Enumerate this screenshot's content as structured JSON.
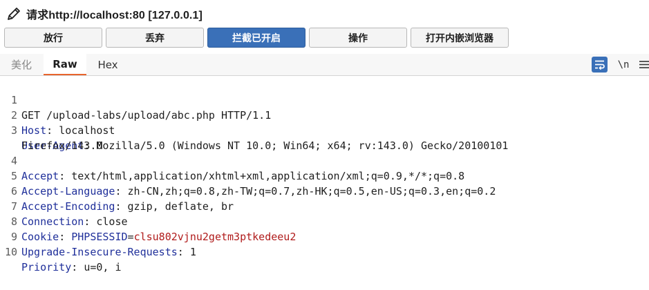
{
  "title": {
    "text": "请求http://localhost:80  [127.0.0.1]",
    "icon": "pencil-icon"
  },
  "buttons": {
    "forward": "放行",
    "drop": "丢弃",
    "intercept": "拦截已开启",
    "action": "操作",
    "open_browser": "打开内嵌浏览器"
  },
  "tabs": {
    "pretty": "美化",
    "raw": "Raw",
    "hex": "Hex",
    "newline_toggle": "\\n"
  },
  "colors": {
    "accent": "#3a70b8",
    "tab_underline": "#e8642c",
    "header_key": "#1f2f9a",
    "cookie_value": "#b01b1b"
  },
  "request": {
    "lines": [
      {
        "num": "1",
        "text": "GET /upload-labs/upload/abc.php HTTP/1.1"
      },
      {
        "num": "2",
        "key": "Host",
        "value": "localhost"
      },
      {
        "num": "3",
        "key": "User-Agent",
        "value": "Mozilla/5.0 (Windows NT 10.0; Win64; x64; rv:143.0) Gecko/20100101",
        "continuation": "Firefox/143.0"
      },
      {
        "num": "4",
        "key": "Accept",
        "value": "text/html,application/xhtml+xml,application/xml;q=0.9,*/*;q=0.8"
      },
      {
        "num": "5",
        "key": "Accept-Language",
        "value": "zh-CN,zh;q=0.8,zh-TW;q=0.7,zh-HK;q=0.5,en-US;q=0.3,en;q=0.2"
      },
      {
        "num": "6",
        "key": "Accept-Encoding",
        "value": "gzip, deflate, br"
      },
      {
        "num": "7",
        "key": "Connection",
        "value": "close"
      },
      {
        "num": "8",
        "key": "Cookie",
        "cookie_name": "PHPSESSID",
        "cookie_value": "clsu802vjnu2getm3ptkedeeu2"
      },
      {
        "num": "9",
        "key": "Upgrade-Insecure-Requests",
        "value": "1"
      },
      {
        "num": "10",
        "key": "Priority",
        "value": "u=0, i"
      }
    ]
  }
}
